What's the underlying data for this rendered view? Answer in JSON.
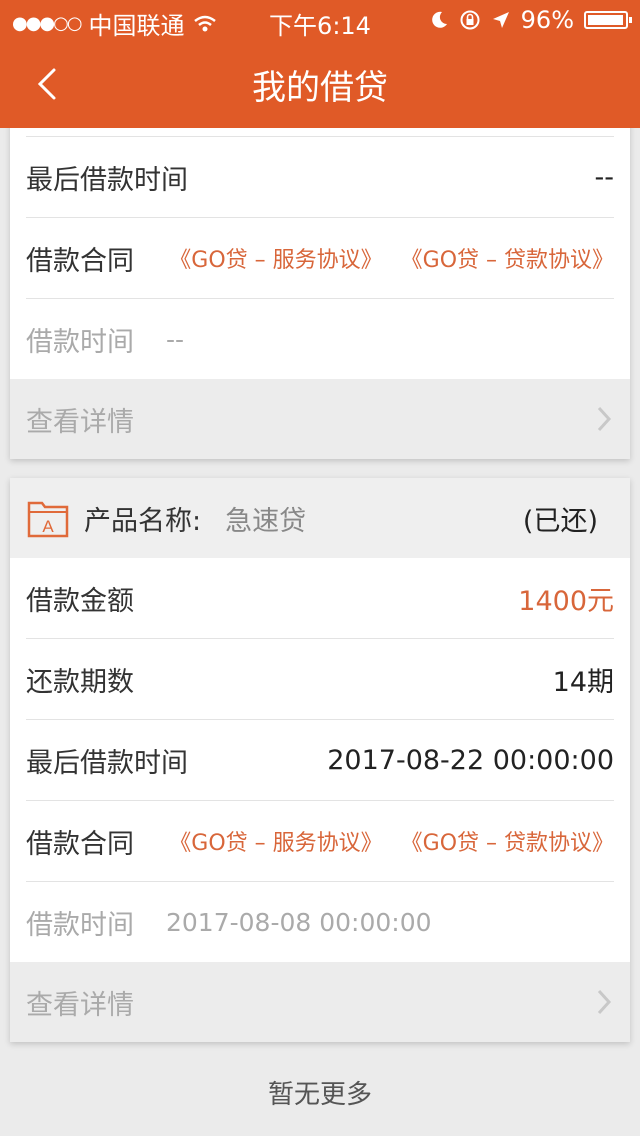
{
  "status_bar": {
    "signal": "●●●○○",
    "carrier": "中国联通",
    "time": "下午6:14",
    "battery": "96%",
    "battery_level": 0.96
  },
  "nav": {
    "title": "我的借贷"
  },
  "card1": {
    "rows": [
      {
        "label": "最后借款时间",
        "value": "--"
      }
    ],
    "contract_label": "借款合同",
    "contracts": [
      "《GO贷 – 服务协议》",
      "《GO贷 – 贷款协议》"
    ],
    "time_label": "借款时间",
    "time_value": "--",
    "detail_label": "查看详情"
  },
  "card2": {
    "header_label": "产品名称:",
    "product_name": "急速贷",
    "status": "(已还)",
    "amount_label": "借款金额",
    "amount_value": "1400元",
    "periods_label": "还款期数",
    "periods_value": "14期",
    "last_time_label": "最后借款时间",
    "last_time_value": "2017-08-22 00:00:00",
    "contract_label": "借款合同",
    "contracts": [
      "《GO贷 – 服务协议》",
      "《GO贷 – 贷款协议》"
    ],
    "time_label": "借款时间",
    "time_value": "2017-08-08 00:00:00",
    "detail_label": "查看详情"
  },
  "footer": {
    "no_more": "暂无更多"
  },
  "colors": {
    "accent": "#e05a27",
    "link": "#d8663a"
  }
}
